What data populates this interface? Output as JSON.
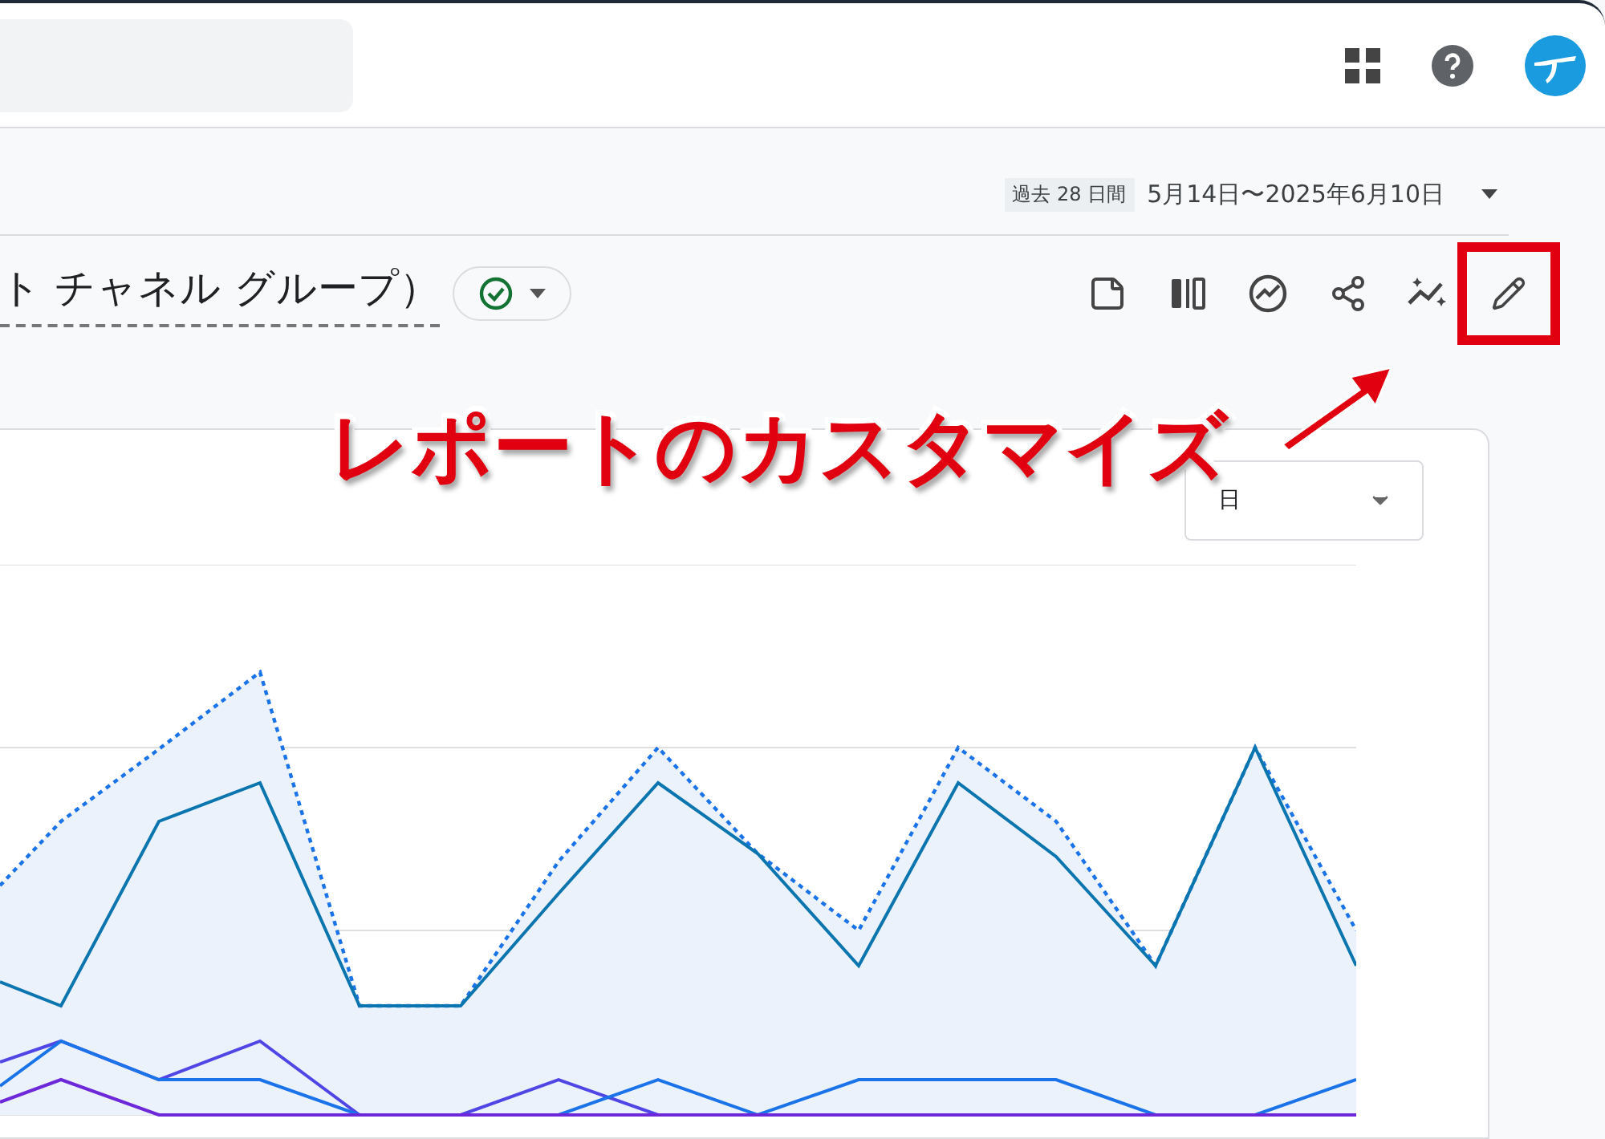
{
  "header": {
    "search": {
      "kind": "search"
    }
  },
  "date_range": {
    "badge": "過去 28 日間",
    "range": "5月14日〜2025年6月10日"
  },
  "report": {
    "title": "ト チャネル グループ）",
    "status": {
      "verified": true
    }
  },
  "toolbar": [
    {
      "kind": "note",
      "highlighted": false
    },
    {
      "kind": "compare",
      "highlighted": false
    },
    {
      "kind": "insights",
      "highlighted": false
    },
    {
      "kind": "share",
      "highlighted": false
    },
    {
      "kind": "sparkle",
      "highlighted": false
    },
    {
      "kind": "edit",
      "highlighted": true
    }
  ],
  "annotation": {
    "text": "レポートのカスタマイズ"
  },
  "chart_card": {
    "granularity": "日"
  }
}
